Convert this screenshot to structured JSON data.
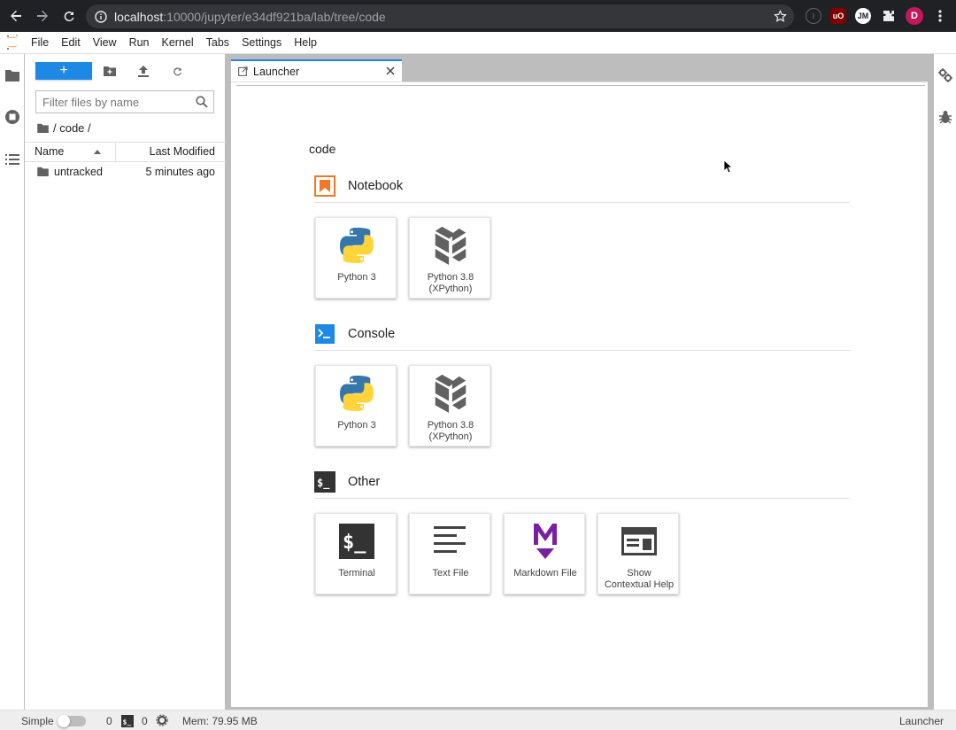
{
  "browser": {
    "url_host": "localhost",
    "url_rest": ":10000/jupyter/e34df921ba/lab/tree/code",
    "profile_initial": "D"
  },
  "menu": {
    "items": [
      "File",
      "Edit",
      "View",
      "Run",
      "Kernel",
      "Tabs",
      "Settings",
      "Help"
    ]
  },
  "filebrowser": {
    "new_label": "+",
    "filter_placeholder": "Filter files by name",
    "breadcrumb": "/ code /",
    "col_name": "Name",
    "col_modified": "Last Modified",
    "files": [
      {
        "name": "untracked",
        "modified": "5 minutes ago"
      }
    ]
  },
  "tabs": [
    {
      "label": "Launcher",
      "active": true
    }
  ],
  "launcher": {
    "cwd": "code",
    "sections": [
      {
        "title": "Notebook",
        "cards": [
          {
            "label": "Python 3",
            "icon": "python-icon"
          },
          {
            "label": "Python 3.8\n(XPython)",
            "icon": "xpython-icon"
          }
        ]
      },
      {
        "title": "Console",
        "cards": [
          {
            "label": "Python 3",
            "icon": "python-icon"
          },
          {
            "label": "Python 3.8\n(XPython)",
            "icon": "xpython-icon"
          }
        ]
      },
      {
        "title": "Other",
        "cards": [
          {
            "label": "Terminal",
            "icon": "terminal-icon"
          },
          {
            "label": "Text File",
            "icon": "text-file-icon"
          },
          {
            "label": "Markdown File",
            "icon": "markdown-icon"
          },
          {
            "label": "Show\nContextual Help",
            "icon": "contextual-help-icon"
          }
        ]
      }
    ]
  },
  "status": {
    "mode_label": "Simple",
    "kernels_count": "0",
    "terminals_count": "0",
    "memory": "Mem: 79.95 MB",
    "active_label": "Launcher"
  },
  "colors": {
    "accent": "#1e88e5",
    "notebook_orange": "#f37726",
    "markdown_purple": "#7b1fa2",
    "xpython_gray": "#616161"
  }
}
